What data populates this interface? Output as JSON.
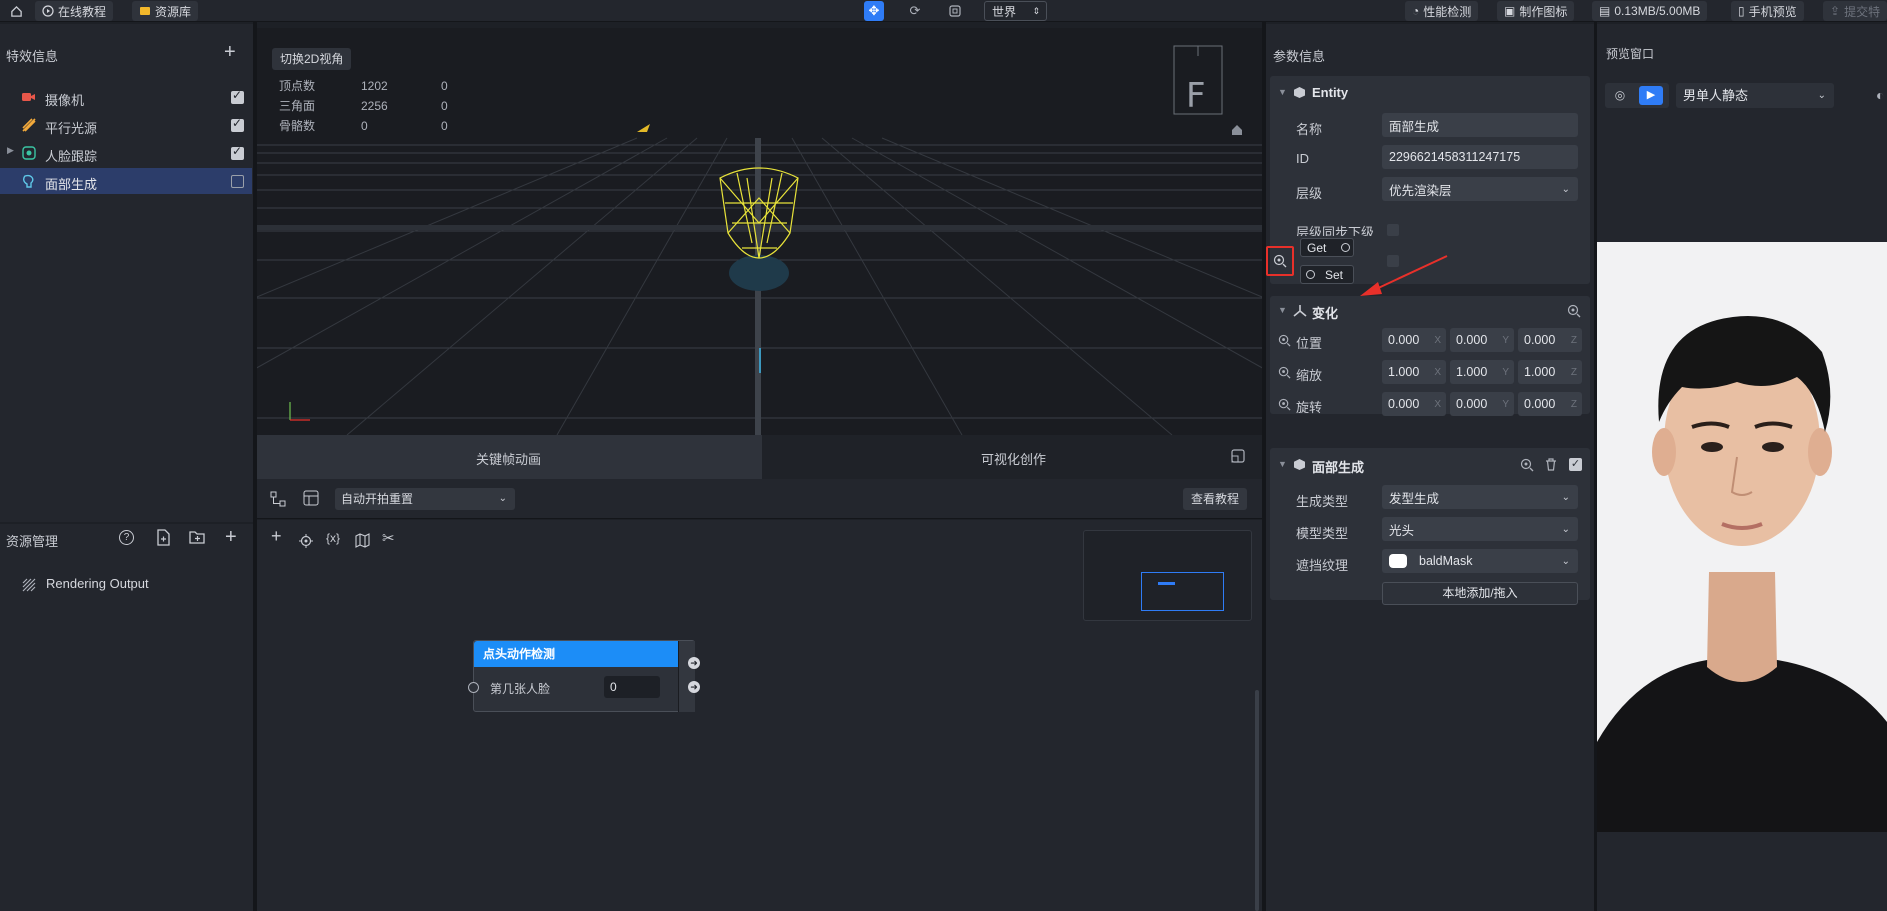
{
  "topbar": {
    "tutorial": "在线教程",
    "assets": "资源库",
    "space": "世界",
    "perf": "性能检测",
    "make_icon": "制作图标",
    "size": "0.13MB/5.00MB",
    "phone_preview": "手机预览",
    "submit": "提交特"
  },
  "effects_panel": {
    "title": "特效信息",
    "items": [
      {
        "label": "摄像机",
        "checked": true
      },
      {
        "label": "平行光源",
        "checked": true
      },
      {
        "label": "人脸跟踪",
        "checked": true
      },
      {
        "label": "面部生成",
        "checked": false
      }
    ]
  },
  "resources_panel": {
    "title": "资源管理",
    "items": [
      {
        "label": "Rendering Output"
      }
    ]
  },
  "viewport": {
    "toggle_2d": "切换2D视角",
    "stats": [
      {
        "label": "顶点数",
        "value": "1202",
        "extra": "0"
      },
      {
        "label": "三角面",
        "value": "2256",
        "extra": "0"
      },
      {
        "label": "骨骼数",
        "value": "0",
        "extra": "0"
      }
    ],
    "gizmo_letter": "F"
  },
  "bottom_tabs": {
    "keyframe": "关键帧动画",
    "visual": "可视化创作"
  },
  "graph_toolbar": {
    "dropdown": "自动开拍重置",
    "tutorial": "查看教程"
  },
  "node": {
    "title": "点头动作检测",
    "param_label": "第几张人脸",
    "param_value": "0"
  },
  "props_panel": {
    "title": "参数信息",
    "entity": {
      "title": "Entity",
      "name_label": "名称",
      "name_value": "面部生成",
      "id_label": "ID",
      "id_value": "2296621458311247175",
      "layer_label": "层级",
      "layer_value": "优先渲染层",
      "sync_label": "层级同步下级",
      "get_label": "Get",
      "set_label": "Set"
    },
    "transform": {
      "title": "变化",
      "rows": [
        {
          "label": "位置",
          "x": "0.000",
          "y": "0.000",
          "z": "0.000"
        },
        {
          "label": "缩放",
          "x": "1.000",
          "y": "1.000",
          "z": "1.000"
        },
        {
          "label": "旋转",
          "x": "0.000",
          "y": "0.000",
          "z": "0.000"
        }
      ],
      "axis_x": "X",
      "axis_y": "Y",
      "axis_z": "Z"
    },
    "face_gen": {
      "title": "面部生成",
      "gen_type_label": "生成类型",
      "gen_type_value": "发型生成",
      "model_type_label": "模型类型",
      "model_type_value": "光头",
      "mask_label": "遮挡纹理",
      "mask_value": "baldMask",
      "add_button": "本地添加/拖入"
    }
  },
  "preview_panel": {
    "title": "预览窗口",
    "select_value": "男单人静态"
  },
  "colors": {
    "accent": "#2f7cf6",
    "node_header": "#1c8df7",
    "annotation_red": "#e8302a",
    "wireframe": "#e8e33a"
  }
}
